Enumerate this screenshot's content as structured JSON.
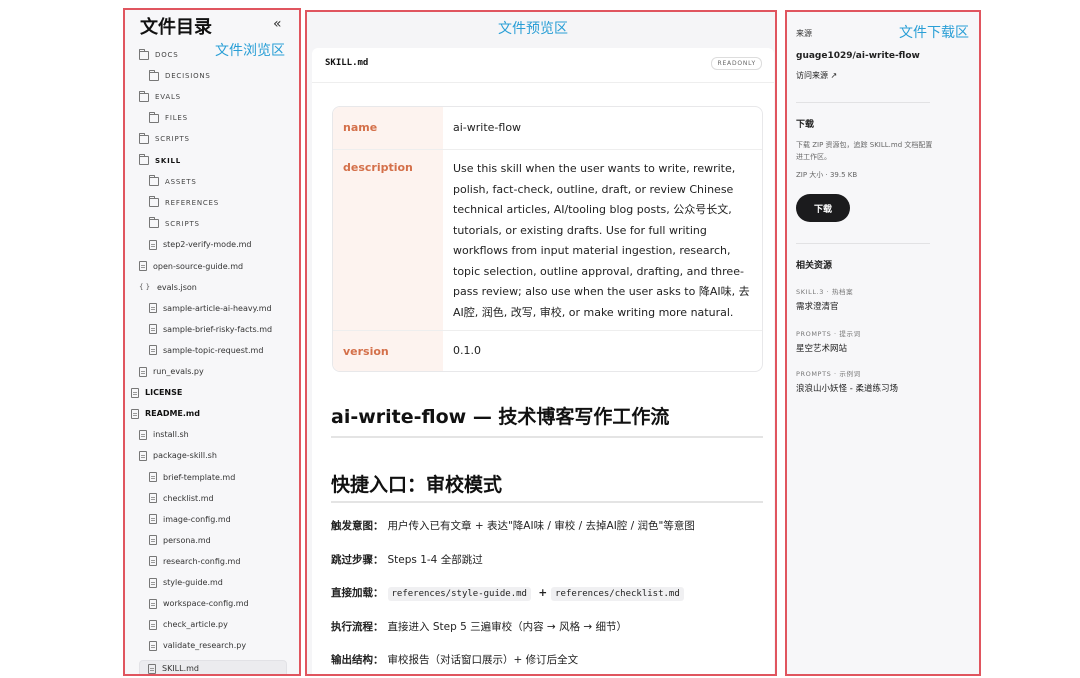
{
  "labels": {
    "browse": "文件浏览区",
    "preview": "文件预览区",
    "download": "文件下载区"
  },
  "tree": {
    "title": "文件目录",
    "collapse_icon": "«",
    "items": [
      {
        "name": "DOCS",
        "type": "folder"
      },
      {
        "name": "DECISIONS",
        "type": "folder"
      },
      {
        "name": "EVALS",
        "type": "folder"
      },
      {
        "name": "FILES",
        "type": "folder"
      },
      {
        "name": "SCRIPTS",
        "type": "folder"
      },
      {
        "name": "SKILL",
        "type": "folder"
      },
      {
        "name": "ASSETS",
        "type": "folder"
      },
      {
        "name": "REFERENCES",
        "type": "folder"
      },
      {
        "name": "SCRIPTS",
        "type": "folder"
      },
      {
        "name": "step2-verify-mode.md",
        "type": "file"
      },
      {
        "name": "open-source-guide.md",
        "type": "file"
      },
      {
        "name": "evals.json",
        "type": "json"
      },
      {
        "name": "sample-article-ai-heavy.md",
        "type": "file"
      },
      {
        "name": "sample-brief-risky-facts.md",
        "type": "file"
      },
      {
        "name": "sample-topic-request.md",
        "type": "file"
      },
      {
        "name": "run_evals.py",
        "type": "file"
      },
      {
        "name": "LICENSE",
        "type": "file"
      },
      {
        "name": "README.md",
        "type": "file"
      },
      {
        "name": "install.sh",
        "type": "file"
      },
      {
        "name": "package-skill.sh",
        "type": "file"
      },
      {
        "name": "brief-template.md",
        "type": "file"
      },
      {
        "name": "checklist.md",
        "type": "file"
      },
      {
        "name": "image-config.md",
        "type": "file"
      },
      {
        "name": "persona.md",
        "type": "file"
      },
      {
        "name": "research-config.md",
        "type": "file"
      },
      {
        "name": "style-guide.md",
        "type": "file"
      },
      {
        "name": "workspace-config.md",
        "type": "file"
      },
      {
        "name": "check_article.py",
        "type": "file"
      },
      {
        "name": "validate_research.py",
        "type": "file"
      },
      {
        "name": "SKILL.md",
        "type": "file",
        "active": true
      }
    ]
  },
  "preview": {
    "filename": "SKILL.md",
    "badge": "READONLY",
    "meta": [
      {
        "key": "name",
        "value": "ai-write-flow"
      },
      {
        "key": "description",
        "value": "Use this skill when the user wants to write, rewrite, polish, fact-check, outline, draft, or review Chinese technical articles, AI/tooling blog posts, 公众号长文, tutorials, or existing drafts. Use for full writing workflows from input material ingestion, research, topic selection, outline approval, drafting, and three-pass review; also use when the user asks to 降AI味, 去AI腔, 润色, 改写, 审校, or make writing more natural."
      },
      {
        "key": "version",
        "value": "0.1.0"
      }
    ],
    "h1": "ai-write-flow — 技术博客写作工作流",
    "h2": "快捷入口：审校模式",
    "paras": [
      {
        "label": "触发意图：",
        "text": "用户传入已有文章 + 表达\"降AI味 / 审校 / 去掉AI腔 / 润色\"等意图"
      },
      {
        "label": "跳过步骤：",
        "text": "Steps 1-4 全部跳过"
      },
      {
        "label": "直接加载：",
        "code1": "references/style-guide.md",
        "plus": "+",
        "code2": "references/checklist.md"
      },
      {
        "label": "执行流程：",
        "text": "直接进入 Step 5 三遍审校（内容 → 风格 → 细节）"
      },
      {
        "label": "输出结构：",
        "text": "审校报告（对话窗口展示）+ 修订后全文"
      }
    ]
  },
  "sidebar": {
    "source_title": "来源",
    "source_repo": "guage1029/ai-write-flow",
    "source_link": "访问来源 ↗",
    "download_title": "下载",
    "download_desc": "下载 ZIP 资源包，追踪 SKILL.md 文档配置进工作区。",
    "zip_size": "ZIP 大小 · 39.5 KB",
    "download_button": "下载",
    "related_title": "相关资源",
    "related": [
      {
        "cap": "SKILL.3 · 热档案",
        "name": "需求澄清官"
      },
      {
        "cap": "PROMPTS · 提示词",
        "name": "星空艺术网站"
      },
      {
        "cap": "PROMPTS · 示例词",
        "name": "浪浪山小妖怪 - 柔道练习场"
      }
    ]
  }
}
